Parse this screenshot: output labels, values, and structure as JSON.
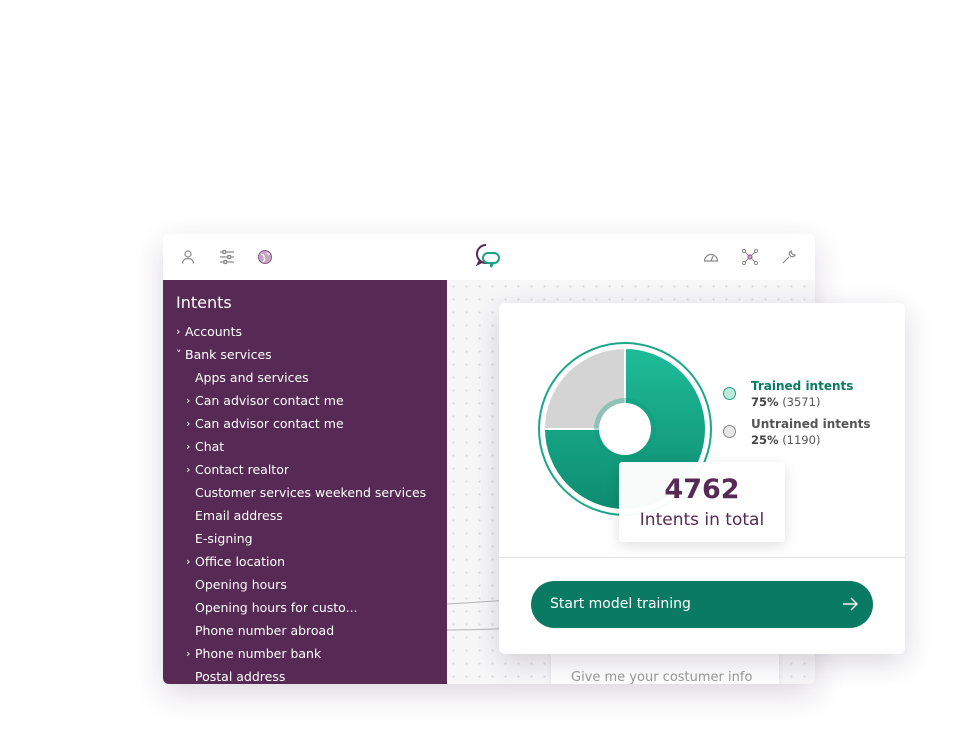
{
  "colors": {
    "sidebar_bg": "#562a55",
    "trained": "#15a184",
    "untrained": "#d4d4d4",
    "button": "#0b7a62",
    "total_text": "#562a55"
  },
  "topbar": {
    "left_icons": [
      "user-icon",
      "sliders-icon",
      "globe-icon"
    ],
    "logo": "chat-bubbles-logo-icon",
    "right_icons": [
      "gauge-icon",
      "network-icon",
      "wrench-icon"
    ]
  },
  "sidebar": {
    "title": "Intents",
    "items": [
      {
        "label": "Accounts",
        "level": 0,
        "chevron": "›"
      },
      {
        "label": "Bank services",
        "level": 0,
        "chevron": "˅"
      },
      {
        "label": "Apps and services",
        "level": 1,
        "chevron": ""
      },
      {
        "label": "Can advisor contact me",
        "level": 1,
        "chevron": "›"
      },
      {
        "label": "Can advisor contact me",
        "level": 1,
        "chevron": "›"
      },
      {
        "label": "Chat",
        "level": 1,
        "chevron": "›"
      },
      {
        "label": "Contact realtor",
        "level": 1,
        "chevron": "›"
      },
      {
        "label": "Customer services weekend services",
        "level": 1,
        "chevron": ""
      },
      {
        "label": "Email address",
        "level": 1,
        "chevron": ""
      },
      {
        "label": "E-signing",
        "level": 1,
        "chevron": ""
      },
      {
        "label": "Office location",
        "level": 1,
        "chevron": "›"
      },
      {
        "label": "Opening hours",
        "level": 1,
        "chevron": ""
      },
      {
        "label": "Opening hours for custo...",
        "level": 1,
        "chevron": ""
      },
      {
        "label": "Phone number abroad",
        "level": 1,
        "chevron": ""
      },
      {
        "label": "Phone number bank",
        "level": 1,
        "chevron": "›"
      },
      {
        "label": "Postal address",
        "level": 1,
        "chevron": ""
      }
    ]
  },
  "canvas": {
    "ghost_text": "Give me your costumer info"
  },
  "stats": {
    "legend": [
      {
        "name": "Trained intents",
        "percent": "75%",
        "count": "(3571)"
      },
      {
        "name": "Untrained intents",
        "percent": "25%",
        "count": "(1190)"
      }
    ],
    "total_number": "4762",
    "total_label": "Intents in total",
    "button_label": "Start model training"
  },
  "chart_data": {
    "type": "pie",
    "categories": [
      "Trained intents",
      "Untrained intents"
    ],
    "values": [
      3571,
      1190
    ],
    "percents": [
      75,
      25
    ]
  }
}
